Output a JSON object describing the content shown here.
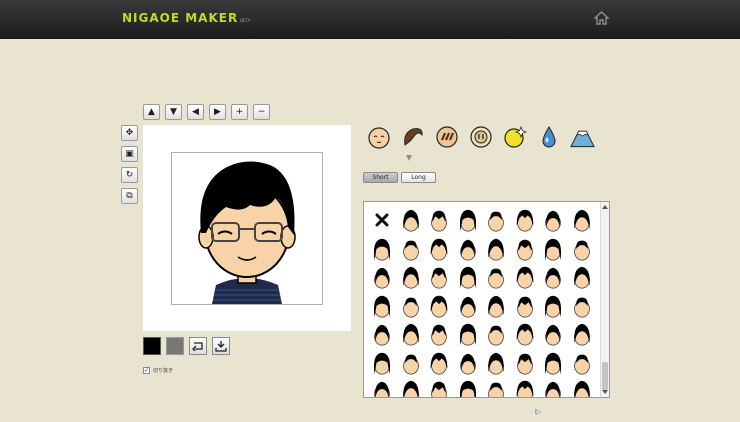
{
  "header": {
    "logo": "NIGAOE MAKER",
    "beta": "BETA",
    "home_icon": "home-icon"
  },
  "nudge_buttons": [
    {
      "name": "move-up-button",
      "glyph": "▲"
    },
    {
      "name": "move-down-button",
      "glyph": "▼"
    },
    {
      "name": "move-left-button",
      "glyph": "◀"
    },
    {
      "name": "move-right-button",
      "glyph": "▶"
    },
    {
      "name": "zoom-in-button",
      "glyph": "+"
    },
    {
      "name": "zoom-out-button",
      "glyph": "−"
    }
  ],
  "tools": [
    {
      "name": "move-tool-button",
      "glyph": "✥"
    },
    {
      "name": "fit-tool-button",
      "glyph": "▣"
    },
    {
      "name": "rotate-tool-button",
      "glyph": "↻"
    },
    {
      "name": "crop-tool-button",
      "glyph": "⧉"
    }
  ],
  "colors": {
    "swatch_primary": "#000000",
    "swatch_secondary": "#777777",
    "accent": "#c8d826"
  },
  "crop_checkbox": {
    "checked": true,
    "label": "切り抜き"
  },
  "categories": [
    "face-icon",
    "hair-icon",
    "eyebrow-icon",
    "nose-icon",
    "effect-icon",
    "sweat-icon",
    "background-icon"
  ],
  "length_toggle": {
    "short": "Short",
    "long": "Long"
  },
  "ad_mark": "i▷"
}
